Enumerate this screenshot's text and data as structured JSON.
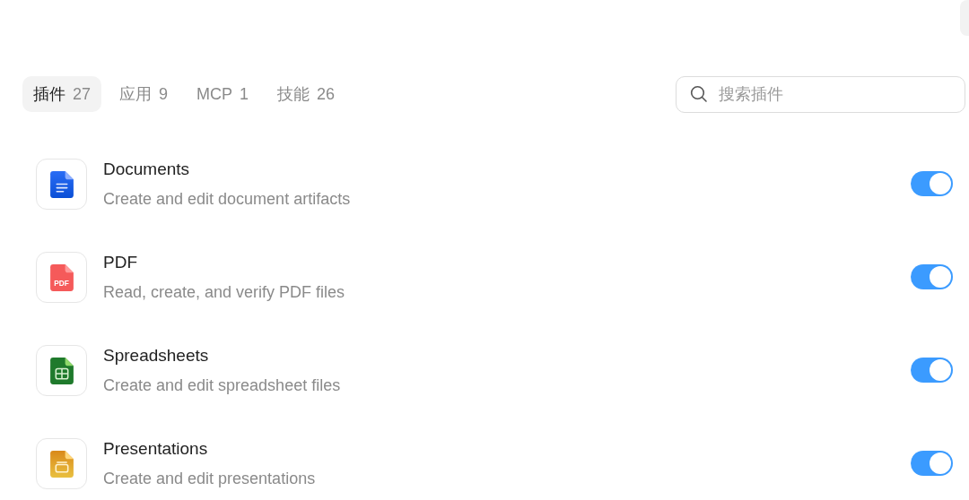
{
  "tabs": [
    {
      "label": "插件",
      "count": "27",
      "selected": true
    },
    {
      "label": "应用",
      "count": "9",
      "selected": false
    },
    {
      "label": "MCP",
      "count": "1",
      "selected": false
    },
    {
      "label": "技能",
      "count": "26",
      "selected": false
    }
  ],
  "search": {
    "placeholder": "搜索插件"
  },
  "plugins": [
    {
      "kind": "document",
      "name": "Documents",
      "description": "Create and edit document artifacts",
      "on": true
    },
    {
      "kind": "pdf",
      "icon_text": "PDF",
      "name": "PDF",
      "description": "Read, create, and verify PDF files",
      "on": true
    },
    {
      "kind": "spreadsheet",
      "name": "Spreadsheets",
      "description": "Create and edit spreadsheet files",
      "on": true
    },
    {
      "kind": "presentation",
      "name": "Presentations",
      "description": "Create and edit presentations",
      "on": true
    }
  ]
}
